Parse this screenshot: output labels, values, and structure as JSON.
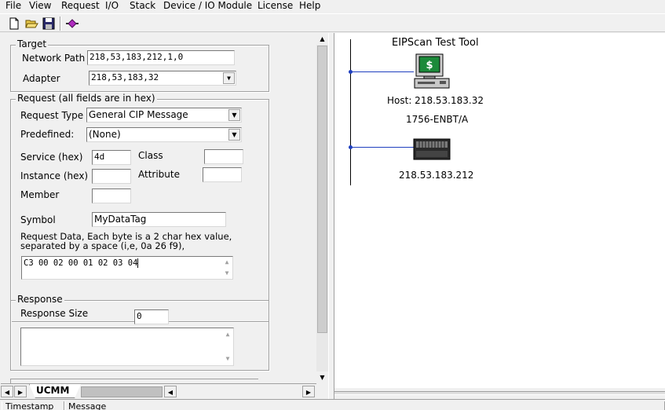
{
  "menu": {
    "items": [
      "File",
      "View",
      "Request",
      "I/O",
      "Stack",
      "Device / IO Module",
      "License",
      "Help"
    ]
  },
  "toolbar": {
    "icons": [
      "new-file-icon",
      "open-folder-icon",
      "save-icon",
      "connect-icon"
    ]
  },
  "target": {
    "legend": "Target",
    "network_path_label": "Network Path",
    "network_path_value": "218,53,183,212,1,0",
    "adapter_label": "Adapter",
    "adapter_value": "218,53,183,32"
  },
  "request": {
    "legend": "Request (all fields are in hex)",
    "request_type_label": "Request Type",
    "request_type_value": "General CIP Message",
    "predefined_label": "Predefined:",
    "predefined_value": "(None)",
    "service_label": "Service (hex)",
    "service_value": "4d",
    "class_label": "Class",
    "class_value": "",
    "instance_label": "Instance (hex)",
    "instance_value": "",
    "attribute_label": "Attribute",
    "attribute_value": "",
    "member_label": "Member",
    "member_value": "",
    "symbol_label": "Symbol",
    "symbol_value": "MyDataTag",
    "data_hint_line1": "Request Data, Each byte is a 2 char hex value,",
    "data_hint_line2": "separated by a space (i,e, 0a 26 f9),",
    "data_value": "C3 00 02 00 01 02 03 04"
  },
  "response": {
    "legend": "Response",
    "size_label": "Response Size",
    "size_value": "0",
    "data_value": ""
  },
  "tabs": {
    "active": "UCMM"
  },
  "diagram": {
    "title": "EIPScan Test Tool",
    "host_label": "Host: 218.53.183.32",
    "module_name": "1756-ENBT/A",
    "module_address": "218.53.183.212"
  },
  "status": {
    "col1": "Timestamp",
    "col2": "Message"
  },
  "colors": {
    "bus_line": "#1f3fbf",
    "monitor_screen": "#1c8a3a",
    "module_body": "#2a2a2a"
  }
}
